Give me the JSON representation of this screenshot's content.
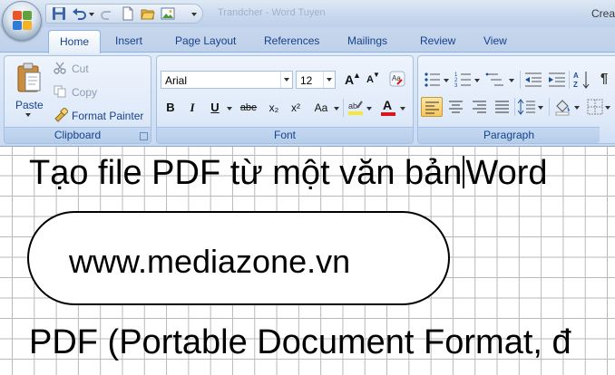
{
  "titlebar": {
    "title_partial": "Creat",
    "ghost_title": "Trandcher - Word Tuyen"
  },
  "tabs": [
    {
      "label": "Home",
      "active": true
    },
    {
      "label": "Insert"
    },
    {
      "label": "Page Layout"
    },
    {
      "label": "References"
    },
    {
      "label": "Mailings"
    },
    {
      "label": "Review"
    },
    {
      "label": "View"
    }
  ],
  "clipboard": {
    "paste": "Paste",
    "cut": "Cut",
    "copy": "Copy",
    "format_painter": "Format Painter",
    "label": "Clipboard"
  },
  "font": {
    "family": "Arial",
    "size": "12",
    "bold": "B",
    "italic": "I",
    "underline": "U",
    "strikethrough": "abe",
    "subscript": "x₂",
    "superscript": "x²",
    "change_case": "Aa",
    "grow": "A",
    "shrink": "A",
    "label": "Font",
    "highlight_color": "#f5e63a",
    "font_color": "#d8161b"
  },
  "paragraph": {
    "label": "Paragraph"
  },
  "document": {
    "heading": "Tạo file PDF từ một văn bản",
    "heading_after_caret": "Word",
    "url": "www.mediazone.vn",
    "body": "PDF (Portable Document Format, đ"
  }
}
